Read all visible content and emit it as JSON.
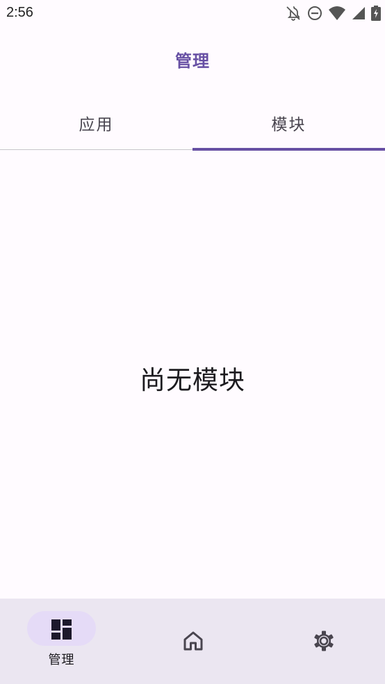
{
  "status_bar": {
    "time": "2:56",
    "icons": [
      "notifications-off-icon",
      "do-not-disturb-icon",
      "wifi-icon",
      "cell-signal-icon",
      "battery-charging-icon"
    ]
  },
  "app_bar": {
    "title": "管理"
  },
  "tabs": [
    {
      "label": "应用",
      "selected": false
    },
    {
      "label": "模块",
      "selected": true
    }
  ],
  "content": {
    "empty_message": "尚无模块"
  },
  "bottom_nav": {
    "items": [
      {
        "label": "管理",
        "icon": "dashboard-icon",
        "selected": true
      },
      {
        "label": "",
        "icon": "home-icon",
        "selected": false
      },
      {
        "label": "",
        "icon": "settings-icon",
        "selected": false
      }
    ]
  },
  "colors": {
    "accent": "#6750a4",
    "background": "#fffbff",
    "nav_background": "#ebe6f1",
    "nav_pill": "#e5dbf7"
  }
}
